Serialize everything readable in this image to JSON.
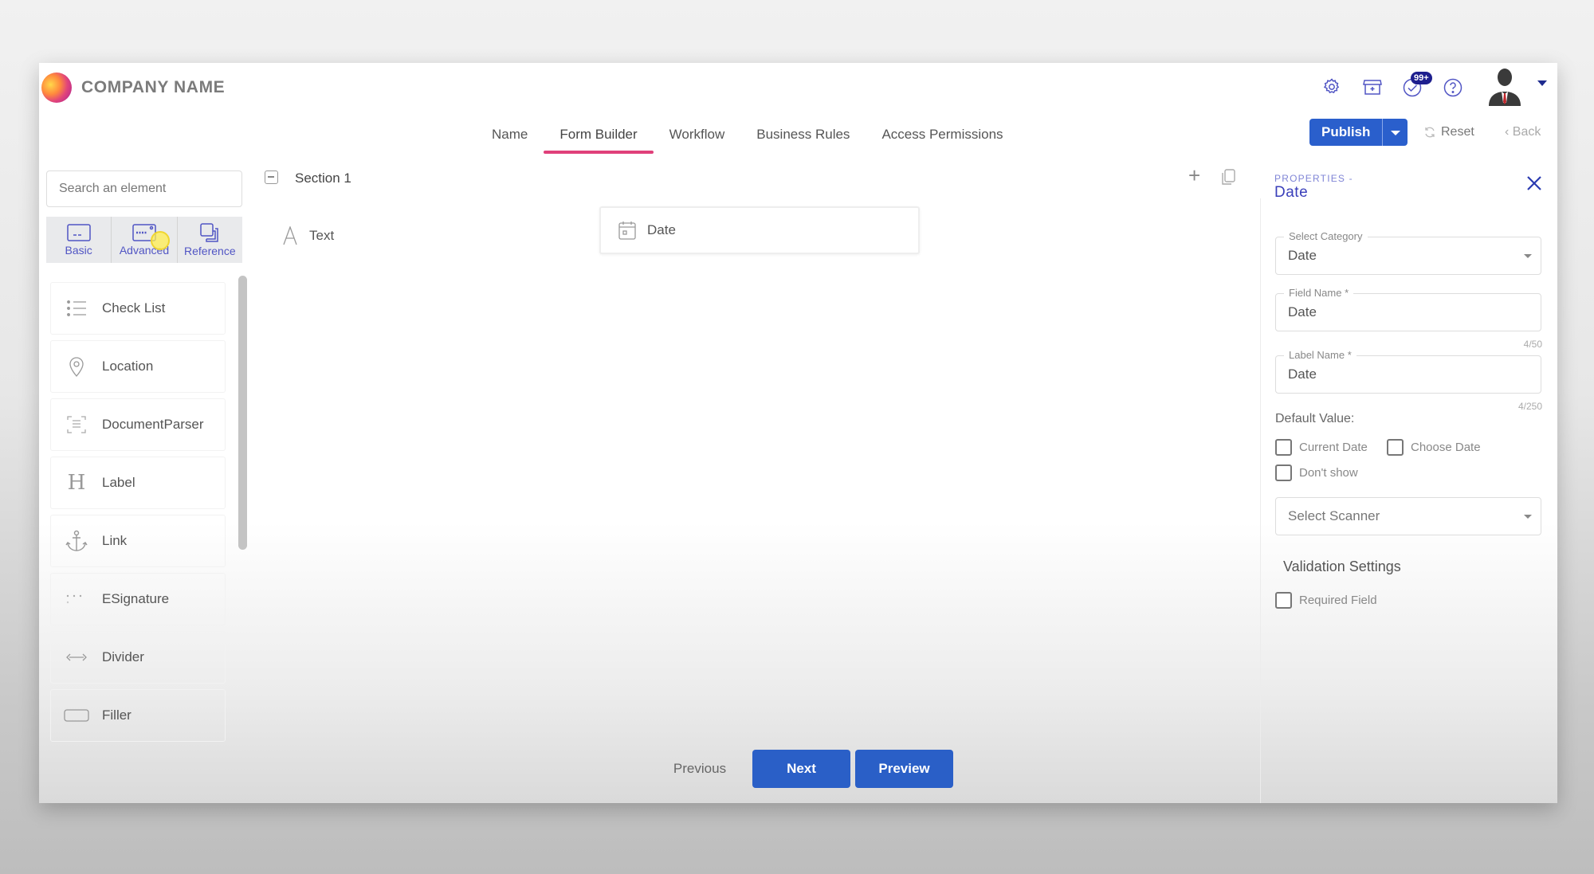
{
  "header": {
    "company_name": "COMPANY NAME",
    "icons": [
      "gear-icon",
      "store-icon",
      "task-check-icon",
      "help-icon"
    ],
    "notification_badge": "99+",
    "avatar": "user-avatar"
  },
  "tabs": [
    {
      "label": "Name",
      "active": false
    },
    {
      "label": "Form Builder",
      "active": true
    },
    {
      "label": "Workflow",
      "active": false
    },
    {
      "label": "Business Rules",
      "active": false
    },
    {
      "label": "Access Permissions",
      "active": false
    }
  ],
  "actions": {
    "publish_label": "Publish",
    "reset_label": "Reset",
    "back_label": "Back"
  },
  "palette": {
    "search_placeholder": "Search an element",
    "categories": [
      {
        "label": "Basic",
        "icon": "basic-field-icon"
      },
      {
        "label": "Advanced",
        "icon": "advanced-field-icon"
      },
      {
        "label": "Reference",
        "icon": "reference-icon"
      }
    ],
    "elements": [
      {
        "label": "Check List",
        "icon": "list-icon"
      },
      {
        "label": "Location",
        "icon": "map-pin-icon"
      },
      {
        "label": "DocumentParser",
        "icon": "scan-document-icon"
      },
      {
        "label": "Label",
        "icon": "heading-icon"
      },
      {
        "label": "Link",
        "icon": "anchor-icon"
      },
      {
        "label": "ESignature",
        "icon": "signature-icon"
      },
      {
        "label": "Divider",
        "icon": "divider-icon"
      },
      {
        "label": "Filler",
        "icon": "filler-icon"
      }
    ]
  },
  "canvas": {
    "section_title": "Section 1",
    "fields": [
      {
        "label": "Text",
        "icon": "text-icon"
      },
      {
        "label": "Date",
        "icon": "calendar-icon",
        "selected": true
      }
    ]
  },
  "properties": {
    "kicker": "PROPERTIES -",
    "title": "Date",
    "select_category": {
      "label": "Select Category",
      "value": "Date"
    },
    "field_name": {
      "label": "Field Name *",
      "value": "Date",
      "counter": "4/50"
    },
    "label_name": {
      "label": "Label Name *",
      "value": "Date",
      "counter": "4/250"
    },
    "default_value_label": "Default Value:",
    "default_options": [
      {
        "label": "Current Date",
        "checked": false
      },
      {
        "label": "Choose Date",
        "checked": false
      },
      {
        "label": "Don't show",
        "checked": false
      }
    ],
    "scanner_placeholder": "Select Scanner",
    "validation_title": "Validation Settings",
    "required_field": {
      "label": "Required Field",
      "checked": false
    }
  },
  "footer": {
    "previous_label": "Previous",
    "next_label": "Next",
    "preview_label": "Preview"
  },
  "colors": {
    "primary": "#2a5fcc",
    "tab_underline": "#e0407a",
    "accent_icon": "#5155c4",
    "badge": "#1e1f8e"
  }
}
